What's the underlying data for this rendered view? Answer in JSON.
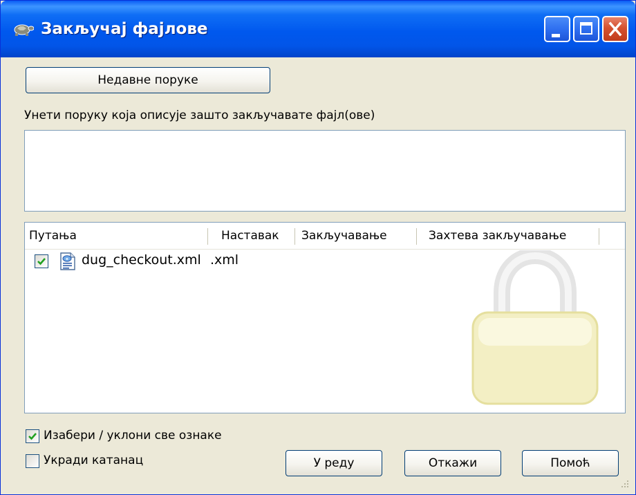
{
  "window": {
    "title": "Закључај фајлове",
    "controls": [
      "minimize",
      "maximize",
      "close"
    ]
  },
  "recent_messages_button": "Недавне поруке",
  "message_prompt": "Унети поруку која описује зашто закључавате фајл(ове)",
  "message_value": "",
  "file_list": {
    "columns": [
      "Путања",
      "Наставак",
      "Закључавање",
      "Захтева закључавање"
    ],
    "rows": [
      {
        "checked": true,
        "path": "dug_checkout.xml",
        "extension": ".xml",
        "locking": "",
        "needs_lock": ""
      }
    ],
    "watermark_icon": "padlock-icon"
  },
  "select_all": {
    "label": "Изабери / уклони све ознаке",
    "checked": true
  },
  "steal_lock": {
    "label": "Укради катанац",
    "checked": false
  },
  "buttons": {
    "ok": "У реду",
    "cancel": "Откажи",
    "help": "Помоћ"
  },
  "colors": {
    "titlebar": "#0058ee",
    "dialog_bg": "#ece9d8",
    "border": "#7f9db9",
    "check": "#21a121"
  }
}
